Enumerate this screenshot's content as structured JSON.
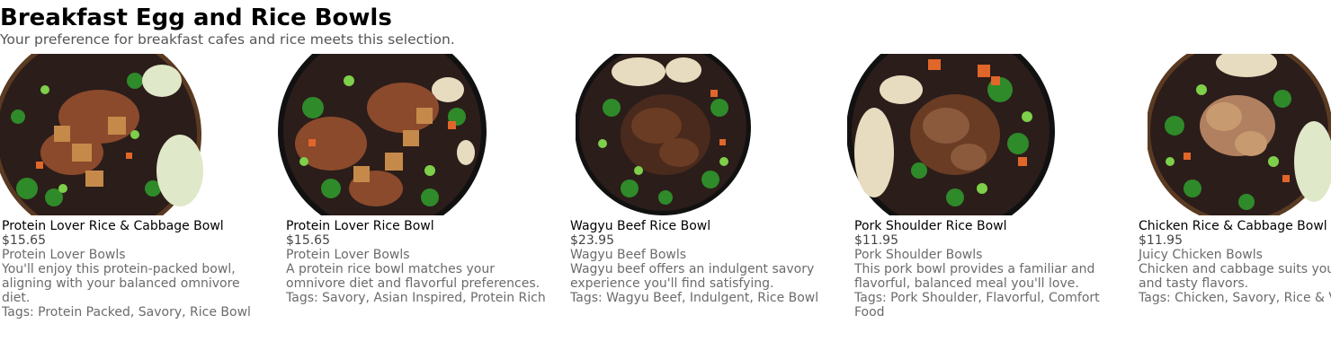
{
  "page": {
    "title": "Breakfast Egg and Rice Bowls",
    "subtitle": "Your preference for breakfast cafes and rice meets this selection."
  },
  "colors": {
    "bowl_rim": "#1a1a1a",
    "rice": "#2b1d1a",
    "meat": "#6a3c24",
    "greens": "#2f8a2a",
    "carrot": "#e0662a",
    "tofu": "#c58a4a",
    "cabbage": "#dfe8c8"
  },
  "items": [
    {
      "name": "Protein Lover Rice & Cabbage Bowl",
      "price": "$15.65",
      "category": "Protein Lover Bowls",
      "description": "You'll enjoy this protein-packed bowl, aligning with your balanced omnivore diet.",
      "tags": "Tags: Protein Packed, Savory, Rice Bowl",
      "image_icon": "rice-cabbage-bowl-photo"
    },
    {
      "name": "Protein Lover Rice Bowl",
      "price": "$15.65",
      "category": "Protein Lover Bowls",
      "description": "A protein rice bowl matches your omnivore diet and flavorful preferences.",
      "tags": "Tags: Savory, Asian Inspired, Protein Rich",
      "image_icon": "rice-bowl-photo"
    },
    {
      "name": "Wagyu Beef Rice Bowl",
      "price": "$23.95",
      "category": "Wagyu Beef Bowls",
      "description": "Wagyu beef offers an indulgent savory experience you'll find satisfying.",
      "tags": "Tags: Wagyu Beef, Indulgent, Rice Bowl",
      "image_icon": "wagyu-bowl-photo"
    },
    {
      "name": "Pork Shoulder Rice Bowl",
      "price": "$11.95",
      "category": "Pork Shoulder Bowls",
      "description": "This pork bowl provides a familiar and flavorful, balanced meal you'll love.",
      "tags": "Tags: Pork Shoulder, Flavorful, Comfort Food",
      "image_icon": "pork-bowl-photo"
    },
    {
      "name": "Chicken Rice & Cabbage Bowl",
      "price": "$11.95",
      "category": "Juicy Chicken Bowls",
      "description": "Chicken and cabbage suits your classic and tasty flavors.",
      "tags": "Tags: Chicken, Savory, Rice & Veggies",
      "image_icon": "chicken-cabbage-bowl-photo"
    }
  ]
}
